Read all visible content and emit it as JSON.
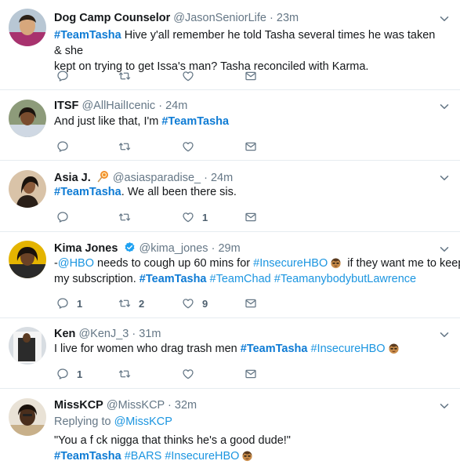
{
  "tweets": [
    {
      "name": "Dog Camp Counselor",
      "handle": "@JasonSeniorLife",
      "time": "23m",
      "text_line1": [
        "#TeamTasha",
        " Hive y'all remember he told Tasha several times he was taken & she"
      ],
      "text_line2": "kept on trying to get Issa's man? Tasha reconciled with Karma.",
      "counts": {
        "reply": "",
        "retweet": "",
        "like": ""
      }
    },
    {
      "name": "ITSF",
      "handle": "@AllHailIcenic",
      "time": "24m",
      "text_prefix": "And just like that, I'm ",
      "text_tag": "#TeamTasha",
      "counts": {
        "reply": "",
        "retweet": "",
        "like": ""
      }
    },
    {
      "name": "Asia J.",
      "handle": "@asiasparadise_",
      "time": "24m",
      "text_tag": "#TeamTasha",
      "text_rest": ". We all been there sis.",
      "counts": {
        "reply": "",
        "retweet": "",
        "like": "1"
      }
    },
    {
      "name": "Kima Jones",
      "handle": "@kima_jones",
      "time": "29m",
      "line1": {
        "a": "-",
        "mention": "@HBO",
        "b": " needs to cough up 60 mins for ",
        "tag": "#InsecureHBO",
        "c": " if they want me to keep"
      },
      "line2": {
        "a": "my subscription. ",
        "tag1": "#TeamTasha",
        "tag2": "#TeamChad",
        "tag3": "#TeamanybodybutLawrence"
      },
      "counts": {
        "reply": "1",
        "retweet": "2",
        "like": "9"
      }
    },
    {
      "name": "Ken",
      "handle": "@KenJ_3",
      "time": "31m",
      "line1": {
        "a": "I live for women who drag trash men ",
        "tag1": "#TeamTasha",
        "tag2": "#InsecureHBO"
      },
      "counts": {
        "reply": "1",
        "retweet": "",
        "like": ""
      }
    },
    {
      "name": "MissKCP",
      "handle": "@MissKCP",
      "time": "32m",
      "replying_prefix": "Replying to ",
      "replying_to": "@MissKCP",
      "quote": "\"You a f  ck nigga that thinks he's a good dude!\"",
      "tags": {
        "t1": "#TeamTasha",
        "t2": "#BARS",
        "t3": "#InsecureHBO"
      }
    }
  ],
  "separator": "·",
  "colors": {
    "link": "#1b95e0",
    "muted": "#657786",
    "verified": "#1da1f2"
  },
  "icons": [
    "reply-icon",
    "retweet-icon",
    "like-icon",
    "dm-icon",
    "chevron-down-icon",
    "verified-icon",
    "lollipop-icon",
    "emoji-face-icon"
  ]
}
